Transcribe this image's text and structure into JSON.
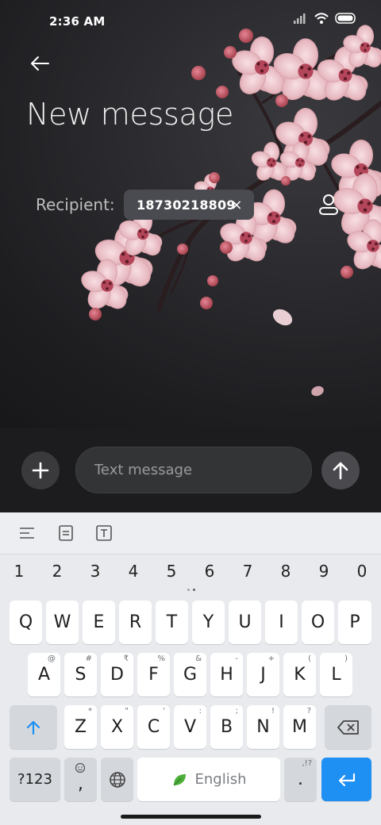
{
  "status": {
    "time": "2:36 AM"
  },
  "header": {
    "title": "New message"
  },
  "recipient": {
    "label": "Recipient:",
    "chip_value": "18730218809",
    "chip_remove": "×"
  },
  "compose": {
    "placeholder": "Text message"
  },
  "keyboard": {
    "numbers": [
      "1",
      "2",
      "3",
      "4",
      "5",
      "6",
      "7",
      "8",
      "9",
      "0"
    ],
    "row1": [
      {
        "l": "Q",
        "h": ""
      },
      {
        "l": "W",
        "h": ""
      },
      {
        "l": "E",
        "h": ""
      },
      {
        "l": "R",
        "h": ""
      },
      {
        "l": "T",
        "h": ""
      },
      {
        "l": "Y",
        "h": ""
      },
      {
        "l": "U",
        "h": ""
      },
      {
        "l": "I",
        "h": ""
      },
      {
        "l": "O",
        "h": ""
      },
      {
        "l": "P",
        "h": ""
      }
    ],
    "row2": [
      {
        "l": "A",
        "h": "@"
      },
      {
        "l": "S",
        "h": "#"
      },
      {
        "l": "D",
        "h": "₹"
      },
      {
        "l": "F",
        "h": "%"
      },
      {
        "l": "G",
        "h": "&"
      },
      {
        "l": "H",
        "h": "-"
      },
      {
        "l": "J",
        "h": "+"
      },
      {
        "l": "K",
        "h": "("
      },
      {
        "l": "L",
        "h": ")"
      }
    ],
    "row3": [
      {
        "l": "Z",
        "h": "*"
      },
      {
        "l": "X",
        "h": "\""
      },
      {
        "l": "C",
        "h": "'"
      },
      {
        "l": "V",
        "h": ":"
      },
      {
        "l": "B",
        "h": ";"
      },
      {
        "l": "N",
        "h": "!"
      },
      {
        "l": "M",
        "h": "?"
      }
    ],
    "symbols_key": "?123",
    "comma_key": ",",
    "space_label": "English",
    "period_key": ".",
    "period_hint": ",!?"
  },
  "colors": {
    "accent": "#1e8ff3",
    "chip_bg": "#4a4b50",
    "keyboard_bg": "#e8eaed"
  }
}
